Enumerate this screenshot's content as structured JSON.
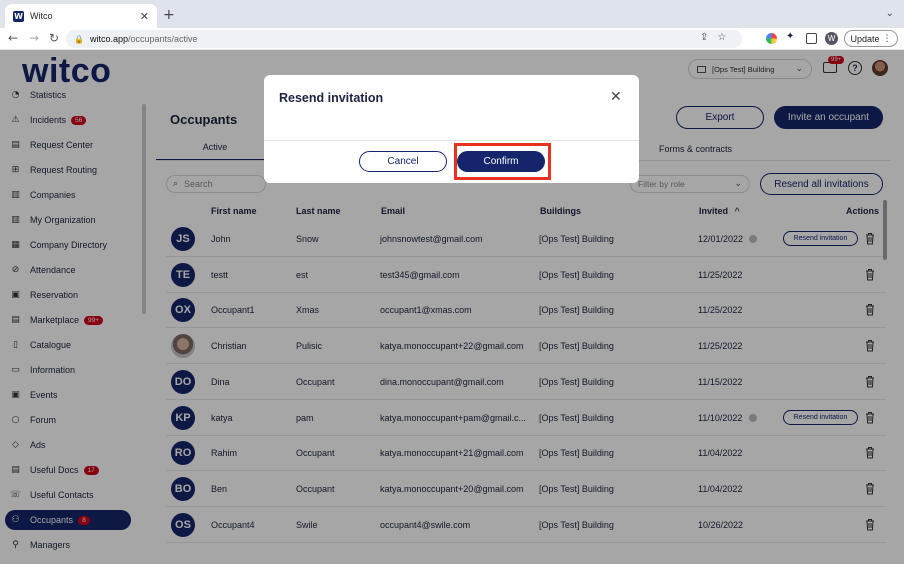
{
  "browser": {
    "tab_title": "Witco",
    "favicon_letter": "W",
    "url_host": "witco.app",
    "url_path": "/occupants/active",
    "profile_letter": "W",
    "update_label": "Update"
  },
  "header": {
    "logo": "witco",
    "building": "[Ops Test] Building",
    "notifications_badge": "99+"
  },
  "sidebar": {
    "items": [
      {
        "label": "Statistics",
        "icon": "chart-icon",
        "badge": ""
      },
      {
        "label": "Incidents",
        "icon": "warning-icon",
        "badge": "56"
      },
      {
        "label": "Request Center",
        "icon": "inbox-icon",
        "badge": ""
      },
      {
        "label": "Request Routing",
        "icon": "routing-icon",
        "badge": ""
      },
      {
        "label": "Companies",
        "icon": "building-icon",
        "badge": ""
      },
      {
        "label": "My Organization",
        "icon": "org-icon",
        "badge": ""
      },
      {
        "label": "Company Directory",
        "icon": "directory-icon",
        "badge": ""
      },
      {
        "label": "Attendance",
        "icon": "check-circle-icon",
        "badge": ""
      },
      {
        "label": "Reservation",
        "icon": "calendar-icon",
        "badge": ""
      },
      {
        "label": "Marketplace",
        "icon": "store-icon",
        "badge": "99+"
      },
      {
        "label": "Catalogue",
        "icon": "book-icon",
        "badge": ""
      },
      {
        "label": "Information",
        "icon": "info-icon",
        "badge": ""
      },
      {
        "label": "Events",
        "icon": "event-icon",
        "badge": ""
      },
      {
        "label": "Forum",
        "icon": "chat-icon",
        "badge": ""
      },
      {
        "label": "Ads",
        "icon": "tag-icon",
        "badge": ""
      },
      {
        "label": "Useful Docs",
        "icon": "document-icon",
        "badge": "17"
      },
      {
        "label": "Useful Contacts",
        "icon": "phone-icon",
        "badge": ""
      },
      {
        "label": "Occupants",
        "icon": "users-icon",
        "badge": "8"
      },
      {
        "label": "Managers",
        "icon": "user-icon",
        "badge": ""
      }
    ]
  },
  "main": {
    "title": "Occupants",
    "export_label": "Export",
    "invite_label": "Invite an occupant",
    "tabs": {
      "active": "Active",
      "forms": "Forms & contracts"
    },
    "search_placeholder": "Search",
    "role_filter_placeholder": "Filter by role",
    "resend_all_label": "Resend all invitations",
    "columns": [
      "First name",
      "Last name",
      "Email",
      "Buildings",
      "Invited",
      "Actions"
    ],
    "sort_indicator": "^",
    "resend_label": "Resend invitation",
    "rows": [
      {
        "initials": "JS",
        "first": "John",
        "last": "Snow",
        "email": "johnsnowtest@gmail.com",
        "building": "[Ops Test] Building",
        "invited": "12/01/2022",
        "pending": true,
        "photo": false
      },
      {
        "initials": "TE",
        "first": "testt",
        "last": "est",
        "email": "test345@gmail.com",
        "building": "[Ops Test] Building",
        "invited": "11/25/2022",
        "pending": false,
        "photo": false
      },
      {
        "initials": "OX",
        "first": "Occupant1",
        "last": "Xmas",
        "email": "occupant1@xmas.com",
        "building": "[Ops Test] Building",
        "invited": "11/25/2022",
        "pending": false,
        "photo": false
      },
      {
        "initials": "",
        "first": "Christian",
        "last": "Pulisic",
        "email": "katya.monoccupant+22@gmail.com",
        "building": "[Ops Test] Building",
        "invited": "11/25/2022",
        "pending": false,
        "photo": true
      },
      {
        "initials": "DO",
        "first": "Dina",
        "last": "Occupant",
        "email": "dina.monoccupant@gmail.com",
        "building": "[Ops Test] Building",
        "invited": "11/15/2022",
        "pending": false,
        "photo": false
      },
      {
        "initials": "KP",
        "first": "katya",
        "last": "pam",
        "email": "katya.monoccupant+pam@gmail.c...",
        "building": "[Ops Test] Building",
        "invited": "11/10/2022",
        "pending": true,
        "photo": false
      },
      {
        "initials": "RO",
        "first": "Rahim",
        "last": "Occupant",
        "email": "katya.monoccupant+21@gmail.com",
        "building": "[Ops Test] Building",
        "invited": "11/04/2022",
        "pending": false,
        "photo": false
      },
      {
        "initials": "BO",
        "first": "Ben",
        "last": "Occupant",
        "email": "katya.monoccupant+20@gmail.com",
        "building": "[Ops Test] Building",
        "invited": "11/04/2022",
        "pending": false,
        "photo": false
      },
      {
        "initials": "OS",
        "first": "Occupant4",
        "last": "Swile",
        "email": "occupant4@swile.com",
        "building": "[Ops Test] Building",
        "invited": "10/26/2022",
        "pending": false,
        "photo": false
      }
    ]
  },
  "modal": {
    "title": "Resend invitation",
    "cancel_label": "Cancel",
    "confirm_label": "Confirm"
  },
  "colors": {
    "brand": "#14256b",
    "badge": "#d0021b",
    "highlight": "#e8321f"
  }
}
